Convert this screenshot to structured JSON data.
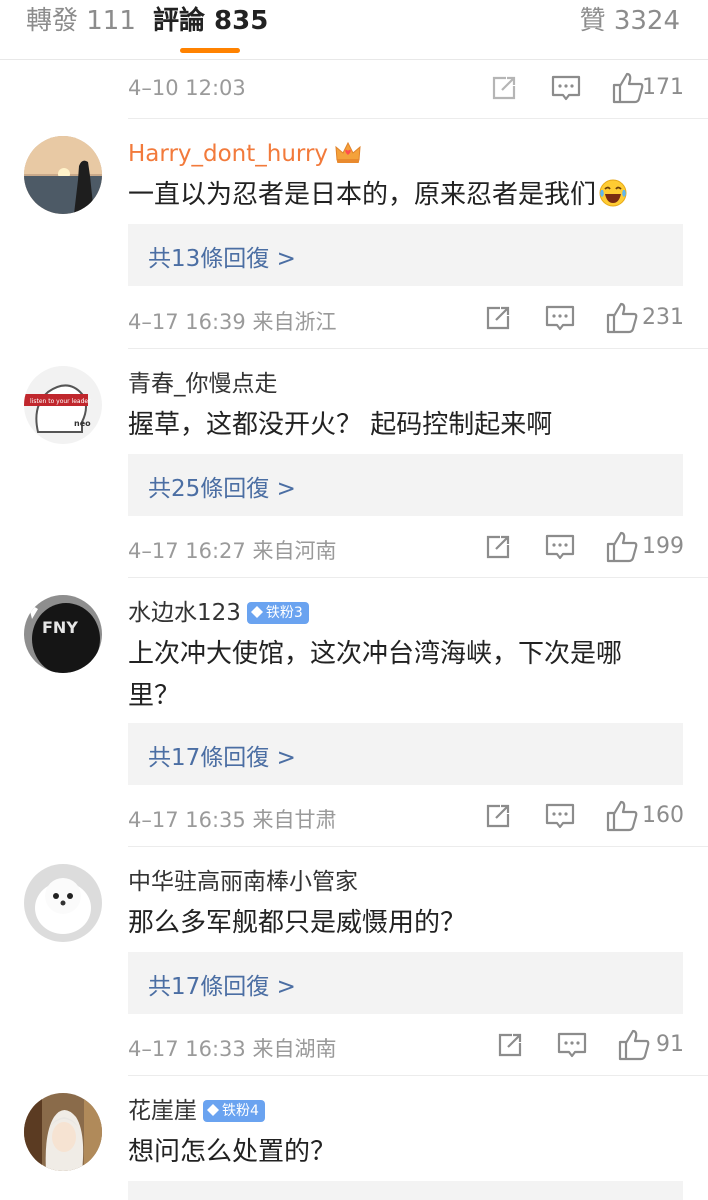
{
  "tabs": {
    "repost": "轉發 111",
    "comments": "評論 835",
    "likes": "贊 3324",
    "accent_color": "#ff8200"
  },
  "top_meta": {
    "time": "4–10 12:03",
    "likes": "171"
  },
  "comments": [
    {
      "username": "Harry_dont_hurry",
      "name_color": "#f27a3b",
      "badge_icon": "crown-icon",
      "text": "一直以为忍者是日本的，原来忍者是我们",
      "emoji": "laughing-tears-emoji",
      "replies": "共13條回復 >",
      "meta": "4–17 16:39  来自浙江",
      "likes": "231"
    },
    {
      "username": "青春_你慢点走",
      "text": "握草，这都没开火？ 起码控制起来啊",
      "replies": "共25條回復 >",
      "meta": "4–17 16:27  来自河南",
      "likes": "199"
    },
    {
      "username": "水边水123",
      "fan_badge": "铁粉3",
      "text": "上次冲大使馆，这次冲台湾海峡，下次是哪里？",
      "replies": "共17條回復 >",
      "meta": "4–17 16:35  来自甘肃",
      "likes": "160"
    },
    {
      "username": "中华驻高丽南棒小管家",
      "text": "那么多军舰都只是威慑用的？",
      "replies": "共17條回復 >",
      "meta": "4–17 16:33  来自湖南",
      "likes": "91"
    },
    {
      "username": "花崖崖",
      "fan_badge": "铁粉4",
      "text": "想问怎么处置的？"
    }
  ],
  "icons": {
    "share": "share-icon",
    "comment": "comment-icon",
    "like": "thumbs-up-icon"
  }
}
